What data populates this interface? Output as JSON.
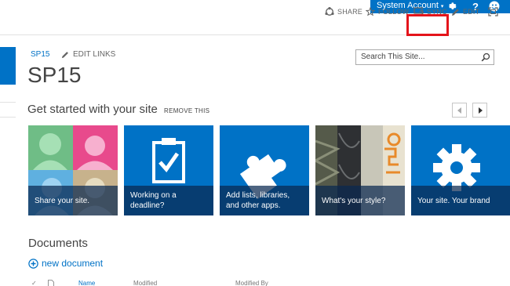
{
  "suite_bar": {
    "account": "System Account",
    "account_caret": "▾",
    "help_glyph": "?"
  },
  "ribbon": {
    "share": "SHARE",
    "follow": "FOLLOW",
    "sync": "SYNC",
    "edit": "EDIT"
  },
  "header": {
    "breadcrumb": "SP15",
    "edit_links": "EDIT LINKS",
    "site_title": "SP15"
  },
  "search": {
    "placeholder": "Search This Site..."
  },
  "get_started": {
    "title": "Get started with your site",
    "remove": "REMOVE THIS",
    "tiles": [
      {
        "caption": "Share your site."
      },
      {
        "caption": "Working on a deadline?"
      },
      {
        "caption": "Add lists, libraries, and other apps."
      },
      {
        "caption": "What's your style?"
      },
      {
        "caption": "Your site. Your brand"
      }
    ]
  },
  "documents": {
    "title": "Documents",
    "new_document": "new document",
    "columns": {
      "check": "✓",
      "name": "Name",
      "modified": "Modified",
      "modified_by": "Modified By"
    }
  },
  "colors": {
    "accent": "#0072c6",
    "highlight": "#e4141b"
  }
}
